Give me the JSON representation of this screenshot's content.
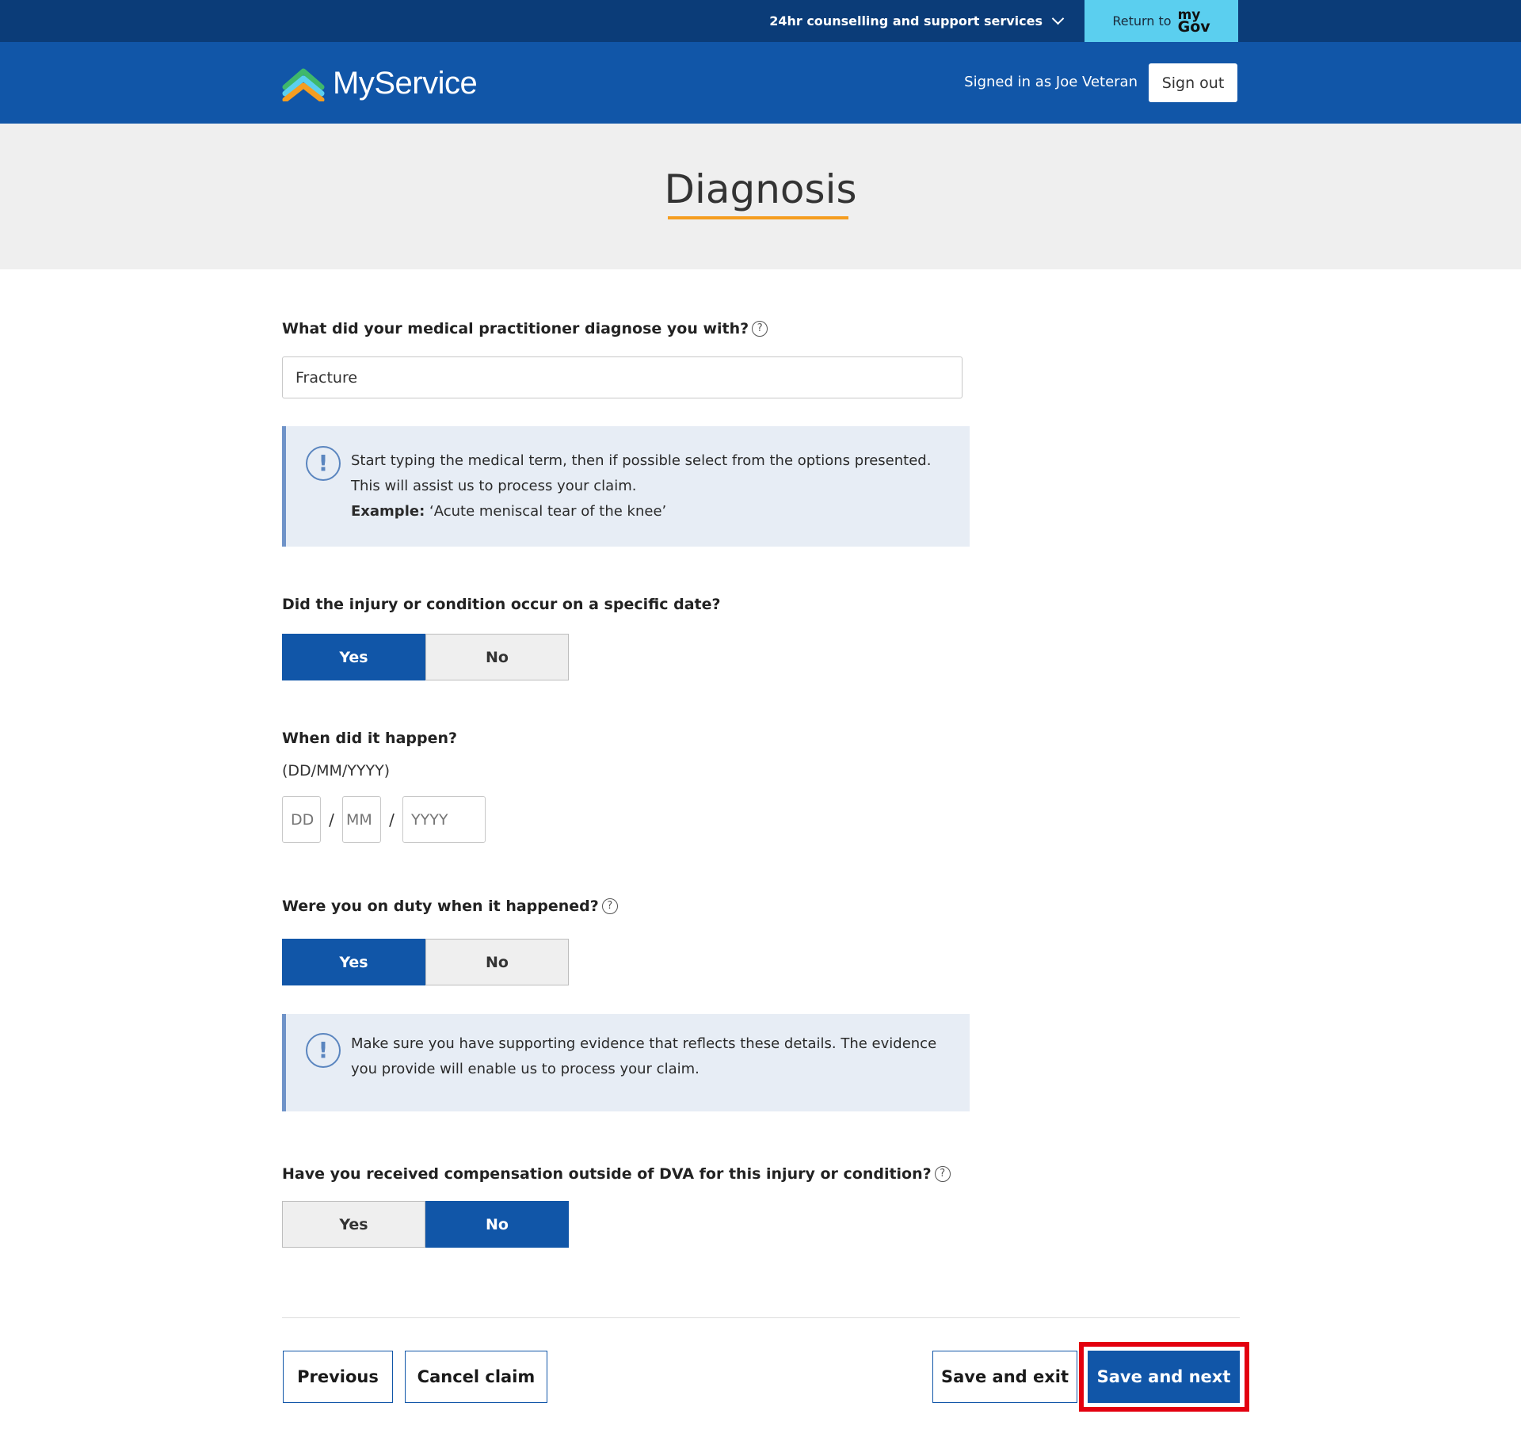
{
  "topbar": {
    "support_label": "24hr counselling and support services",
    "return_label": "Return to",
    "mygov_top": "my",
    "mygov_bottom": "Gov"
  },
  "header": {
    "app_name": "MyService",
    "signed_in_text": "Signed in as Joe Veteran",
    "signout_label": "Sign out"
  },
  "page": {
    "title": "Diagnosis"
  },
  "form": {
    "diagnosis": {
      "question": "What did your medical practitioner diagnose you with?",
      "value": "Fracture",
      "info_line1": "Start typing the medical term, then if possible select from the options presented.",
      "info_line2": "This will assist us to process your claim.",
      "example_label": "Example:",
      "example_text": "‘Acute meniscal tear of the knee’"
    },
    "specific_date": {
      "question": "Did the injury or condition occur on a specific date?",
      "yes_label": "Yes",
      "no_label": "No",
      "selected": "Yes"
    },
    "when": {
      "question": "When did it happen?",
      "hint": "(DD/MM/YYYY)",
      "day_placeholder": "DD",
      "month_placeholder": "MM",
      "year_placeholder": "YYYY",
      "separator": "/"
    },
    "on_duty": {
      "question": "Were you on duty when it happened?",
      "yes_label": "Yes",
      "no_label": "No",
      "selected": "Yes",
      "info_line1": "Make sure you have supporting evidence that reflects these details. The evidence",
      "info_line2": "you provide will enable us to process your claim."
    },
    "compensation": {
      "question": "Have you received compensation outside of DVA for this injury or condition?",
      "yes_label": "Yes",
      "no_label": "No",
      "selected": "No"
    }
  },
  "footer": {
    "previous_label": "Previous",
    "cancel_label": "Cancel claim",
    "save_exit_label": "Save and exit",
    "save_next_label": "Save and next"
  },
  "colors": {
    "topbar": "#0b3c78",
    "header": "#1156a8",
    "accent_underline": "#f59d20",
    "mygov_button": "#5bcfef",
    "highlight_box": "#e3000f"
  },
  "icons": {
    "support_toggle": "chevron-down-icon",
    "logo": "myservice-logo-icon",
    "help": "question-circle-icon",
    "info": "exclamation-circle-icon"
  }
}
